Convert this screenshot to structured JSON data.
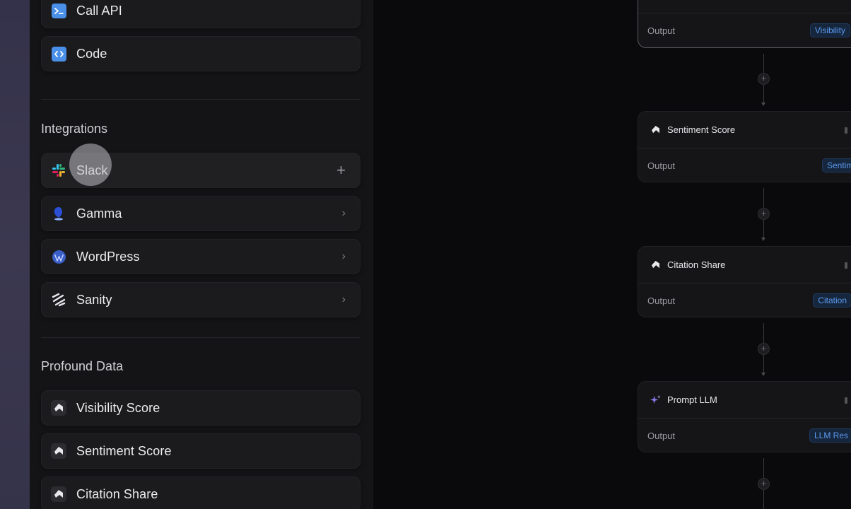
{
  "sidebar": {
    "tools": [
      {
        "label": "Call API",
        "icon": "terminal-icon"
      },
      {
        "label": "Code",
        "icon": "code-icon"
      }
    ],
    "integrations_title": "Integrations",
    "integrations": [
      {
        "label": "Slack",
        "icon": "slack-icon",
        "trail": "+"
      },
      {
        "label": "Gamma",
        "icon": "gamma-icon",
        "trail": "›"
      },
      {
        "label": "WordPress",
        "icon": "wordpress-icon",
        "trail": "›"
      },
      {
        "label": "Sanity",
        "icon": "sanity-icon",
        "trail": "›"
      }
    ],
    "profound_title": "Profound Data",
    "profound": [
      {
        "label": "Visibility Score",
        "icon": "profound-icon"
      },
      {
        "label": "Sentiment Score",
        "icon": "profound-icon"
      },
      {
        "label": "Citation Share",
        "icon": "profound-icon"
      }
    ]
  },
  "flow": {
    "nodes": [
      {
        "title": "",
        "output_label": "Output",
        "output_badge": "Visibility"
      },
      {
        "title": "Sentiment Score",
        "output_label": "Output",
        "output_badge": "Sentiment"
      },
      {
        "title": "Citation Share",
        "output_label": "Output",
        "output_badge": "Citation"
      },
      {
        "title": "Prompt LLM",
        "output_label": "Output",
        "output_badge": "LLM Res"
      }
    ],
    "add_step": "+"
  },
  "colors": {
    "accent_blue": "#4a8fe8",
    "badge_text": "#5b9bef",
    "sidebar_bg": "#141416"
  }
}
